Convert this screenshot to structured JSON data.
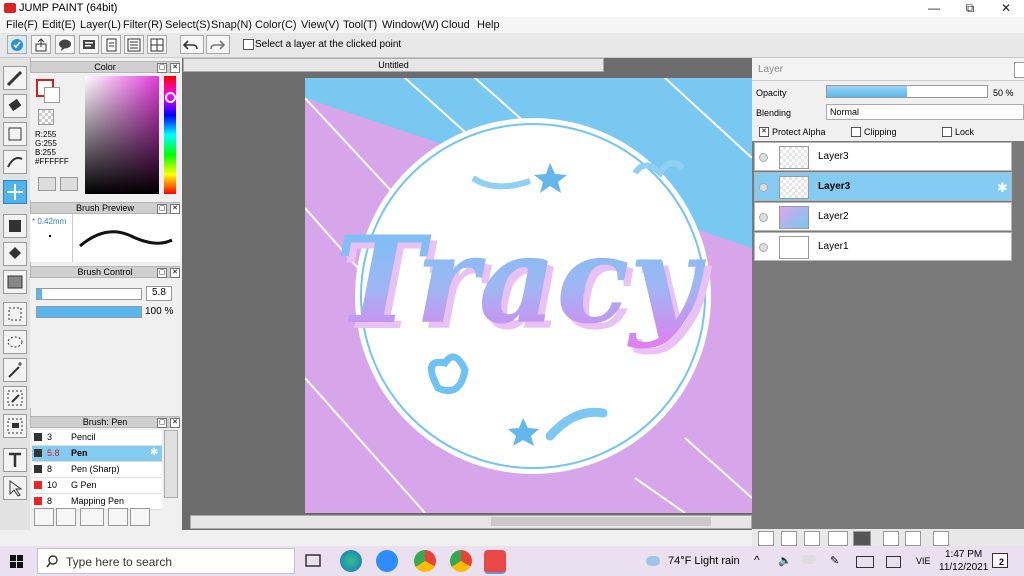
{
  "window": {
    "title": "JUMP PAINT (64bit)",
    "minimize": "—",
    "maximize": "⧉",
    "close": "✕"
  },
  "menu": [
    "File(F)",
    "Edit(E)",
    "Layer(L)",
    "Filter(R)",
    "Select(S)",
    "Snap(N)",
    "Color(C)",
    "View(V)",
    "Tool(T)",
    "Window(W)",
    "Cloud",
    "Help"
  ],
  "toolbar": {
    "select_layer_label": "Select a layer at the clicked point"
  },
  "color_panel": {
    "title": "Color",
    "r": "R:255",
    "g": "G:255",
    "b": "B:255",
    "hex": "#FFFFFF",
    "primary": "#ffffff",
    "accent": "#d22020"
  },
  "brush_preview": {
    "title": "Brush Preview",
    "size": "* 0.42mm"
  },
  "brush_control": {
    "title": "Brush Control",
    "size_value": "5.8",
    "opacity_value": "100 %",
    "size_fraction": 0.05,
    "opacity_fraction": 1.0
  },
  "brush_list": {
    "title": "Brush: Pen",
    "items": [
      {
        "size": "3",
        "name": "Pencil",
        "color": "#333333"
      },
      {
        "size": "5.8",
        "name": "Pen",
        "color": "#333333",
        "selected": true
      },
      {
        "size": "8",
        "name": "Pen (Sharp)",
        "color": "#333333"
      },
      {
        "size": "10",
        "name": "G Pen",
        "color": "#ee2222"
      },
      {
        "size": "8",
        "name": "Mapping Pen",
        "color": "#ee2222"
      }
    ]
  },
  "document": {
    "tab_title": "Untitled"
  },
  "canvas": {
    "text": "Tracy",
    "bg_blue": "#79c8f2",
    "bg_purple": "#d7a6ea"
  },
  "layer_panel": {
    "title": "Layer",
    "opacity_label": "Opacity",
    "opacity_value": "50 %",
    "opacity_fraction": 0.5,
    "blending_label": "Blending",
    "blending_value": "Normal",
    "protect_alpha": "Protect Alpha",
    "clipping": "Clipping",
    "lock": "Lock",
    "layers": [
      {
        "name": "Layer3",
        "selected": false
      },
      {
        "name": "Layer3",
        "selected": true
      },
      {
        "name": "Layer2",
        "selected": false
      },
      {
        "name": "Layer1",
        "selected": false
      }
    ]
  },
  "taskbar": {
    "search_placeholder": "Type here to search",
    "weather": "74°F  Light rain",
    "lang": "VIE",
    "time": "1:47 PM",
    "date": "11/12/2021",
    "notifications": "2"
  }
}
